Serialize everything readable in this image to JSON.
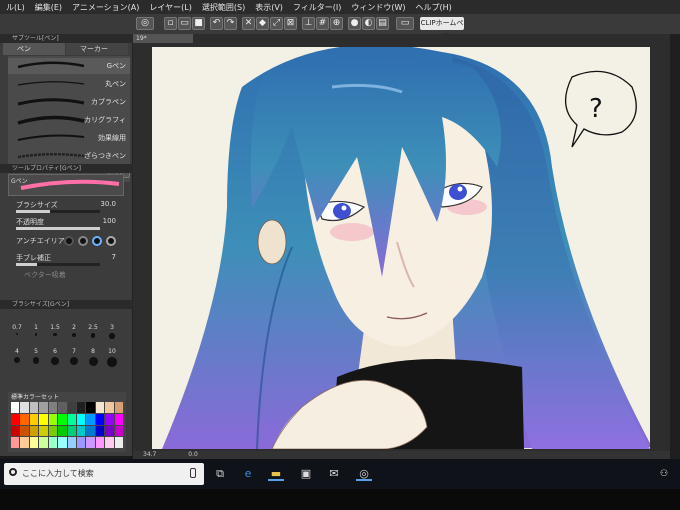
{
  "menu": [
    "ル(L)",
    "編集(E)",
    "アニメーション(A)",
    "レイヤー(L)",
    "選択範囲(S)",
    "表示(V)",
    "フィルター(I)",
    "ウィンドウ(W)",
    "ヘルプ(H)"
  ],
  "toolbar": {
    "clip_home": "CLIPホームページ"
  },
  "subtool": {
    "header": "サブツール[ペン]",
    "tabs": [
      "ペン",
      "マーカー"
    ],
    "brushes": [
      "Gペン",
      "丸ペン",
      "カブラペン",
      "カリグラフィ",
      "効果線用",
      "ざらつきペン"
    ],
    "selected_index": 0
  },
  "toolprop": {
    "header": "ツールプロパティ[Gペン]",
    "preview_label": "Gペン",
    "brush_size_label": "ブラシサイズ",
    "brush_size_value": "30.0",
    "opacity_label": "不透明度",
    "opacity_value": "100",
    "antialias_label": "アンチエイリアス",
    "stabilize_label": "手ブレ補正",
    "stabilize_value": "7",
    "vector_label": "ベクター吸着"
  },
  "brushsize": {
    "header": "ブラシサイズ[Gペン]",
    "sizes": [
      "0.7",
      "1",
      "1.5",
      "2",
      "2.5",
      "3",
      "4",
      "5",
      "6",
      "7",
      "8",
      "10"
    ]
  },
  "colorset": {
    "header": "標準カラーセット",
    "colors": [
      "#ffffff",
      "#e0e0e0",
      "#c0c0c0",
      "#a0a0a0",
      "#808080",
      "#606060",
      "#404040",
      "#202020",
      "#000000",
      "#f5e6d0",
      "#f0c8a0",
      "#d8a070",
      "#ff0000",
      "#ff6600",
      "#ffcc00",
      "#ffff00",
      "#99ff00",
      "#00ff00",
      "#00ff99",
      "#00ffff",
      "#0099ff",
      "#0000ff",
      "#9900ff",
      "#ff00ff",
      "#cc0000",
      "#cc5200",
      "#cca300",
      "#cccc00",
      "#7acc00",
      "#00cc00",
      "#00cc7a",
      "#00cccc",
      "#007acc",
      "#0000cc",
      "#7a00cc",
      "#cc00cc",
      "#ff9999",
      "#ffcc99",
      "#ffff99",
      "#ccff99",
      "#99ffcc",
      "#99ffff",
      "#99ccff",
      "#9999ff",
      "#cc99ff",
      "#ff99ff",
      "#ffccee",
      "#eeeeee"
    ]
  },
  "document": {
    "tab_label": "19*",
    "zoom": "34.7",
    "angle": "0.0"
  },
  "taskbar": {
    "search_placeholder": "ここに入力して検索"
  }
}
